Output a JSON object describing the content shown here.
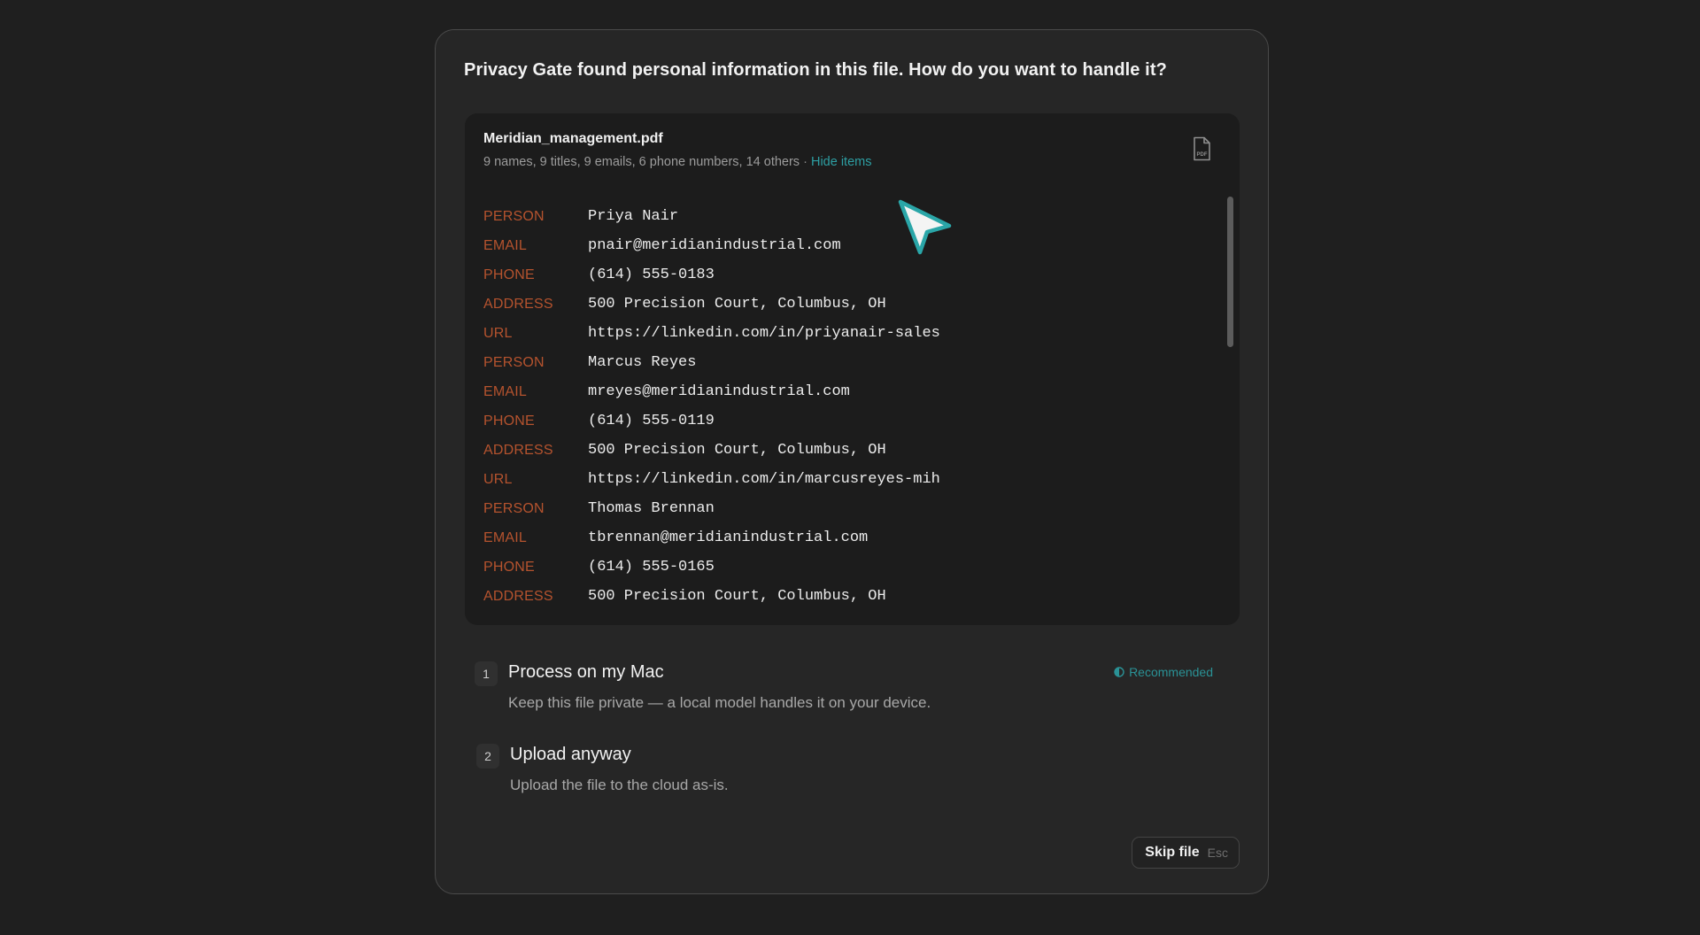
{
  "dialog": {
    "title": "Privacy Gate found personal information in this file. How do you want to handle it?"
  },
  "file": {
    "name": "Meridian_management.pdf",
    "summary": "9 names, 9 titles, 9 emails, 6 phone numbers, 14 others",
    "separator": "·",
    "hide_link": "Hide items",
    "icon_label": "PDF",
    "items": [
      {
        "type": "PERSON",
        "value": "Priya Nair"
      },
      {
        "type": "EMAIL",
        "value": "pnair@meridianindustrial.com"
      },
      {
        "type": "PHONE",
        "value": "(614) 555-0183"
      },
      {
        "type": "ADDRESS",
        "value": "500 Precision Court, Columbus, OH"
      },
      {
        "type": "URL",
        "value": "https://linkedin.com/in/priyanair-sales"
      },
      {
        "type": "PERSON",
        "value": "Marcus Reyes"
      },
      {
        "type": "EMAIL",
        "value": "mreyes@meridianindustrial.com"
      },
      {
        "type": "PHONE",
        "value": "(614) 555-0119"
      },
      {
        "type": "ADDRESS",
        "value": "500 Precision Court, Columbus, OH"
      },
      {
        "type": "URL",
        "value": "https://linkedin.com/in/marcusreyes-mih"
      },
      {
        "type": "PERSON",
        "value": "Thomas Brennan"
      },
      {
        "type": "EMAIL",
        "value": "tbrennan@meridianindustrial.com"
      },
      {
        "type": "PHONE",
        "value": "(614) 555-0165"
      },
      {
        "type": "ADDRESS",
        "value": "500 Precision Court, Columbus, OH"
      }
    ]
  },
  "options": [
    {
      "number": "1",
      "title": "Process on my Mac",
      "description": "Keep this file private — a local model handles it on your device.",
      "badge": "Recommended"
    },
    {
      "number": "2",
      "title": "Upload anyway",
      "description": "Upload the file to the cloud as-is."
    }
  ],
  "skip": {
    "label": "Skip file",
    "shortcut": "Esc"
  },
  "colors": {
    "entity_type": "#b5532e",
    "accent": "#2d9fa3",
    "cursor_fill": "#f4f4f4",
    "cursor_outline": "#2aa6a8"
  }
}
